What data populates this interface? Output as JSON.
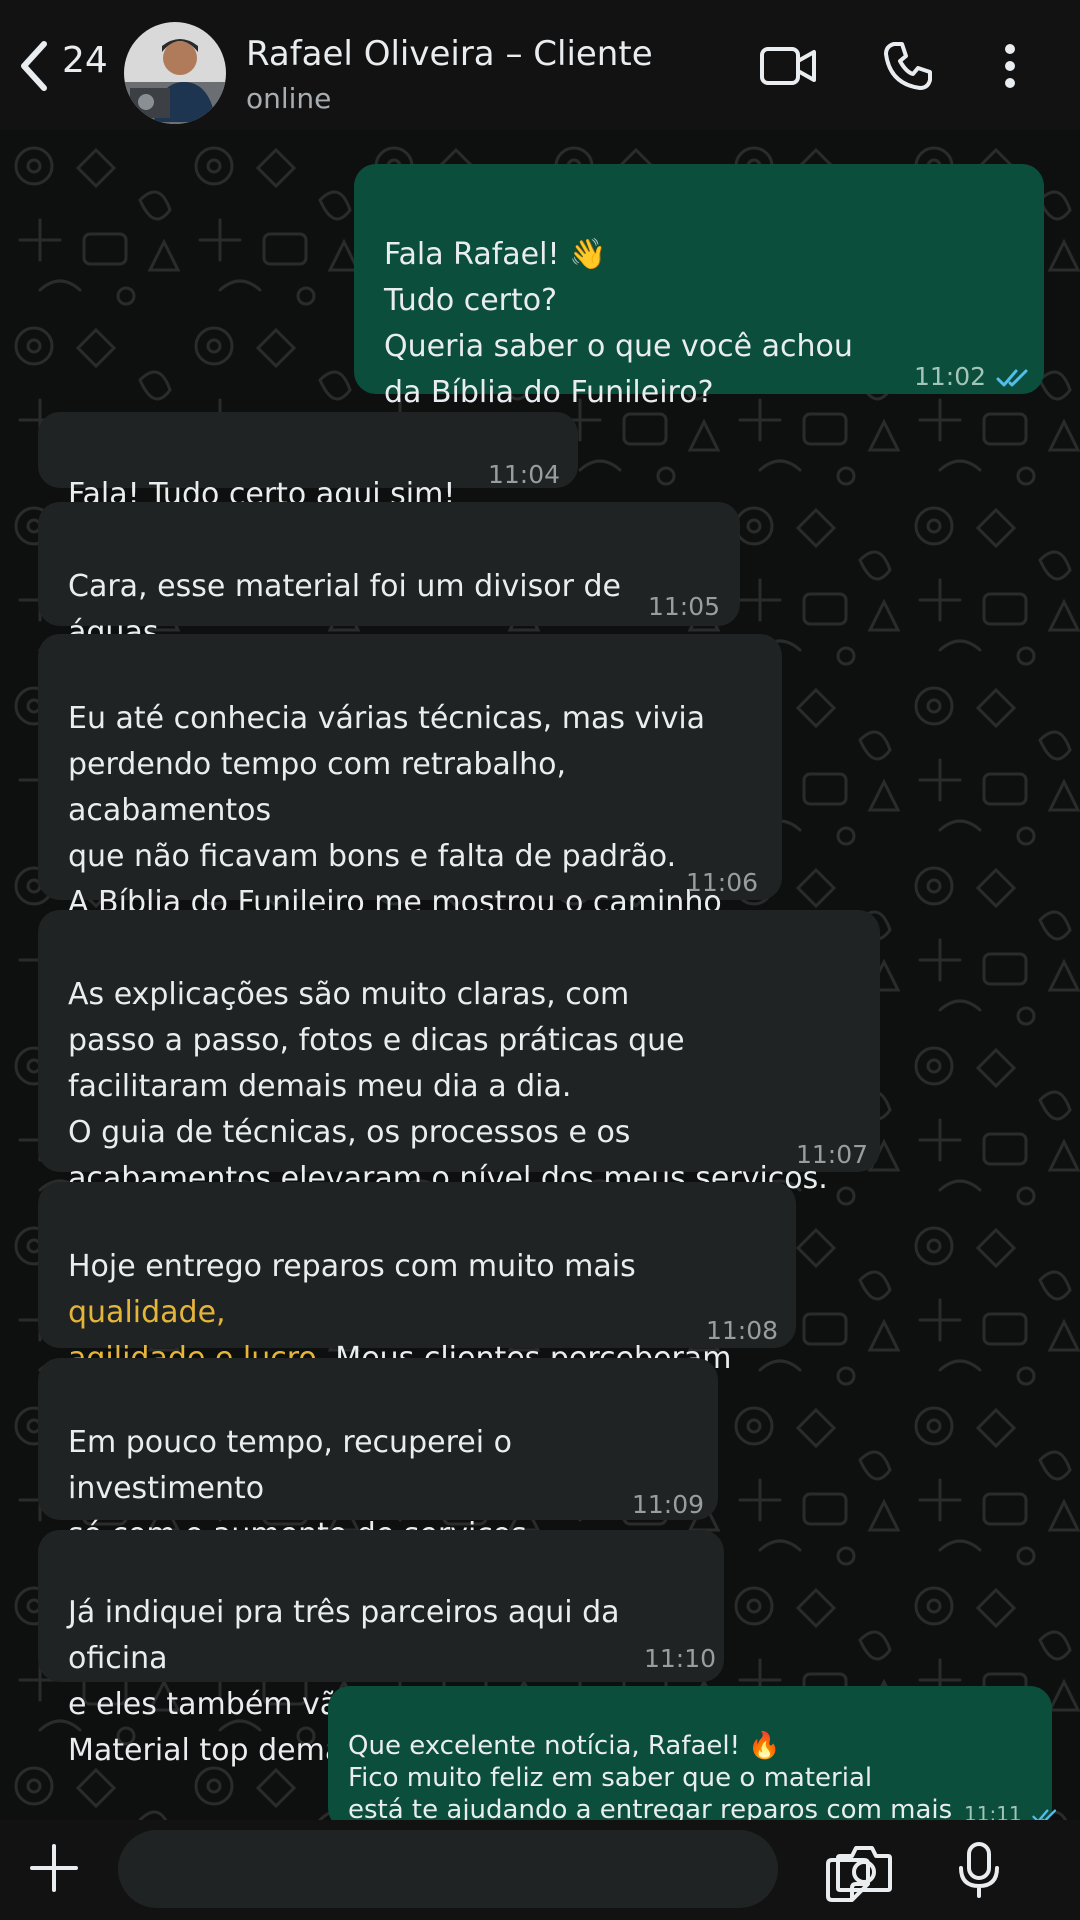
{
  "header": {
    "unread_count": "24",
    "contact_name": "Rafael Oliveira – Cliente",
    "status": "online"
  },
  "messages": [
    {
      "side": "out",
      "text": "Fala Rafael! 👋\nTudo certo?\nQueria saber o que você achou\nda Bíblia do Funileiro?",
      "time": "11:02",
      "read": true
    },
    {
      "side": "in",
      "text": "Fala! Tudo certo aqui sim!",
      "time": "11:04"
    },
    {
      "side": "in",
      "text": "Cara, esse material foi um divisor de águas\npra mim na funilaria!",
      "time": "11:05"
    },
    {
      "side": "in",
      "text": "Eu até conhecia várias técnicas, mas vivia\nperdendo tempo com retrabalho, acabamentos\nque não ficavam bons e falta de padrão.\nA Bíblia do Funileiro me mostrou o caminho\ncerto...",
      "time": "11:06"
    },
    {
      "side": "in",
      "text": "As explicações são muito claras, com\npasso a passo, fotos e dicas práticas que\nfacilitaram demais meu dia a dia.\nO guia de técnicas, os processos e os\nacabamentos elevaram o nível dos meus serviços.",
      "time": "11:07"
    },
    {
      "side": "in",
      "text_before": "Hoje entrego reparos com muito mais ",
      "text_highlight": "qualidade,\nagilidade e lucro",
      "text_after": ". Meus clientes perceberam\na diferença e indicaram mais serviços!",
      "time": "11:08"
    },
    {
      "side": "in",
      "text": "Em pouco tempo, recuperei o investimento\nsó com o aumento de serviços realizados\ne o fim do retrabalho! 💰📈",
      "time": "11:09"
    },
    {
      "side": "in",
      "text": "Já indiquei pra três parceiros aqui da oficina\ne eles também vão comprar.\nMaterial top demais!",
      "time": "11:10"
    },
    {
      "side": "out",
      "text": "Que excelente notícia, Rafael! 🔥\nFico muito feliz em saber que o material\nestá te ajudando a entregar reparos com mais\nqualidade, agilidade e lucro! Sucesso sempre! 👊",
      "time": "11:11",
      "read": true
    }
  ],
  "colors": {
    "incoming_bubble": "#202323",
    "outgoing_bubble": "#0b4e3b",
    "highlight": "#e5b53a",
    "read_tick": "#53bdeb"
  },
  "icons": [
    "back-chevron-icon",
    "video-call-icon",
    "phone-icon",
    "more-vert-icon",
    "plus-icon",
    "sticker-icon",
    "camera-icon",
    "mic-icon"
  ]
}
